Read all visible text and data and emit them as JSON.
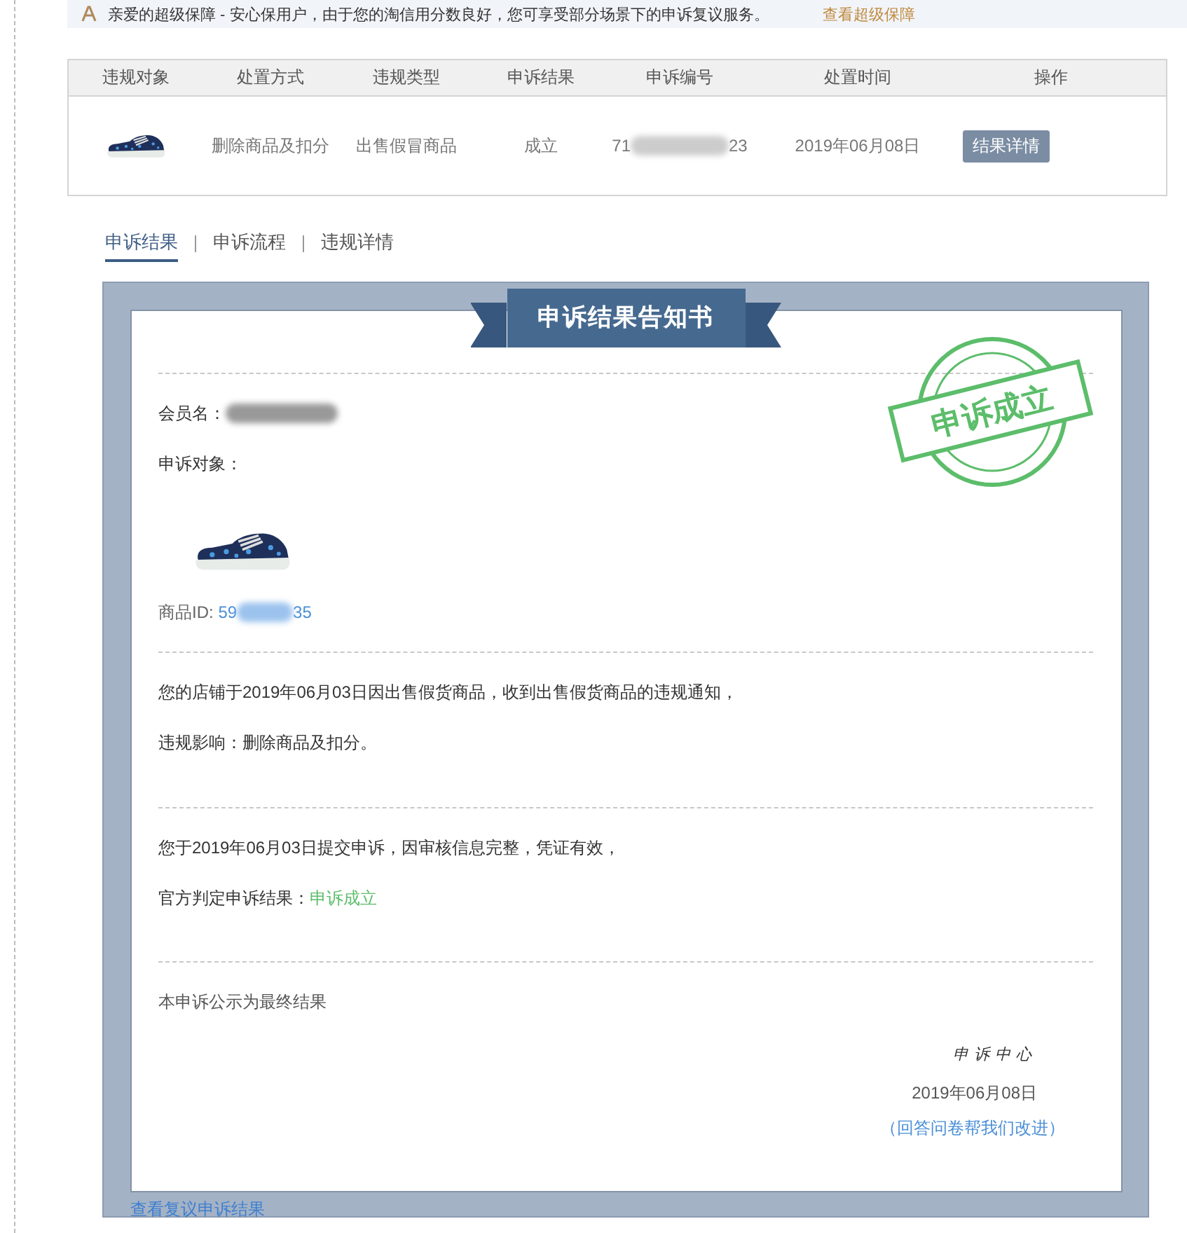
{
  "banner": {
    "message": "亲爱的超级保障 - 安心保用户，由于您的淘信用分数良好，您可享受部分场景下的申诉复议服务。",
    "link": "查看超级保障"
  },
  "table": {
    "columns": [
      "违规对象",
      "处置方式",
      "违规类型",
      "申诉结果",
      "申诉编号",
      "处置时间",
      "操作"
    ],
    "rows": [
      {
        "process": "删除商品及扣分",
        "type": "出售假冒商品",
        "result": "成立",
        "appeal_number_start": "71",
        "appeal_number_end": "23",
        "time": "2019年06月08日",
        "action": "结果详情"
      }
    ]
  },
  "tabs": [
    {
      "label": "申诉结果",
      "selected": true
    },
    {
      "label": "申诉流程",
      "selected": false
    },
    {
      "label": "违规详情",
      "selected": false
    }
  ],
  "notice": {
    "title": "申诉结果告知书",
    "stamp": "申诉成立",
    "member_label": "会员名：",
    "object_label": "申诉对象：",
    "product_id_label": "商品ID:",
    "product_id_start": "59",
    "product_id_end": "35",
    "violation_text": "您的店铺于2019年06月03日因出售假货商品，收到出售假货商品的违规通知，",
    "impact_text": "违规影响：删除商品及扣分。",
    "appeal_text": "您于2019年06月03日提交申诉，因审核信息完整，凭证有效，",
    "verdict_label": "官方判定申诉结果：",
    "verdict": "申诉成立",
    "final_note": "本申诉公示为最终结果",
    "signature": "申诉中心",
    "date": "2019年06月08日",
    "survey_link": "（回答问卷帮我们改进）"
  },
  "review_link": "查看复议申诉结果"
}
